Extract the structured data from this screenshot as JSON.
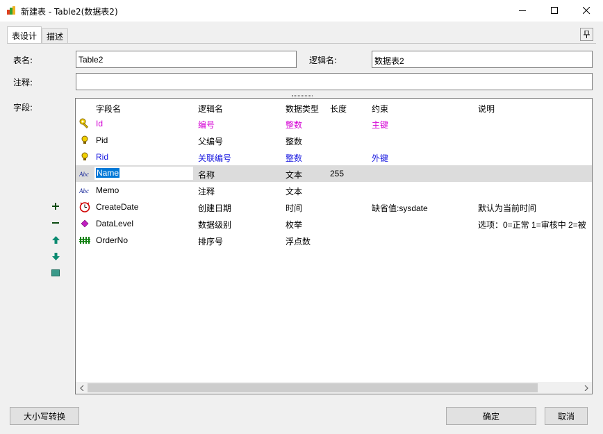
{
  "window": {
    "title": "新建表 - Table2(数据表2)",
    "minimize_glyph": "—",
    "maximize_glyph": "☐",
    "close_glyph": "✕"
  },
  "tabs": [
    {
      "label": "表设计",
      "active": true
    },
    {
      "label": "描述",
      "active": false
    }
  ],
  "pin_glyph": "⊥",
  "form": {
    "table_name_label": "表名:",
    "table_name_value": "Table2",
    "logical_name_label": "逻辑名:",
    "logical_name_value": "数据表2",
    "comment_label": "注释:",
    "comment_value": "",
    "fields_label": "字段:"
  },
  "grid": {
    "columns": [
      "字段名",
      "逻辑名",
      "数据类型",
      "长度",
      "约束",
      "说明"
    ],
    "rows": [
      {
        "icon": "primary-key-icon",
        "name": "Id",
        "logical": "编号",
        "type": "整数",
        "length": "",
        "constraint": "主键",
        "desc": "",
        "color": "pink"
      },
      {
        "icon": "index-bulb-icon",
        "name": "Pid",
        "logical": "父编号",
        "type": "整数",
        "length": "",
        "constraint": "",
        "desc": "",
        "color": "black"
      },
      {
        "icon": "index-bulb-icon",
        "name": "Rid",
        "logical": "关联编号",
        "type": "整数",
        "length": "",
        "constraint": "外键",
        "desc": "",
        "color": "blue"
      },
      {
        "icon": "text-type-icon",
        "name": "Name",
        "logical": "名称",
        "type": "文本",
        "length": "255",
        "constraint": "",
        "desc": "",
        "color": "black"
      },
      {
        "icon": "text-type-icon",
        "name": "Memo",
        "logical": "注释",
        "type": "文本",
        "length": "",
        "constraint": "",
        "desc": "",
        "color": "black"
      },
      {
        "icon": "clock-icon",
        "name": "CreateDate",
        "logical": "创建日期",
        "type": "时间",
        "length": "",
        "constraint": "缺省值:sysdate",
        "desc": "默认为当前时间",
        "color": "black"
      },
      {
        "icon": "diamond-icon",
        "name": "DataLevel",
        "logical": "数据级别",
        "type": "枚举",
        "length": "",
        "constraint": "",
        "desc": "选项：0=正常 1=审核中 2=被",
        "color": "black"
      },
      {
        "icon": "number-type-icon",
        "name": "OrderNo",
        "logical": "排序号",
        "type": "浮点数",
        "length": "",
        "constraint": "",
        "desc": "",
        "color": "black"
      }
    ],
    "selected_row": 3
  },
  "buttons": {
    "case_convert": "大小写转换",
    "ok": "确定",
    "cancel": "取消"
  },
  "colors": {
    "pink": "#d400d4",
    "blue": "#1a1ae0",
    "selection": "#0078d7"
  }
}
